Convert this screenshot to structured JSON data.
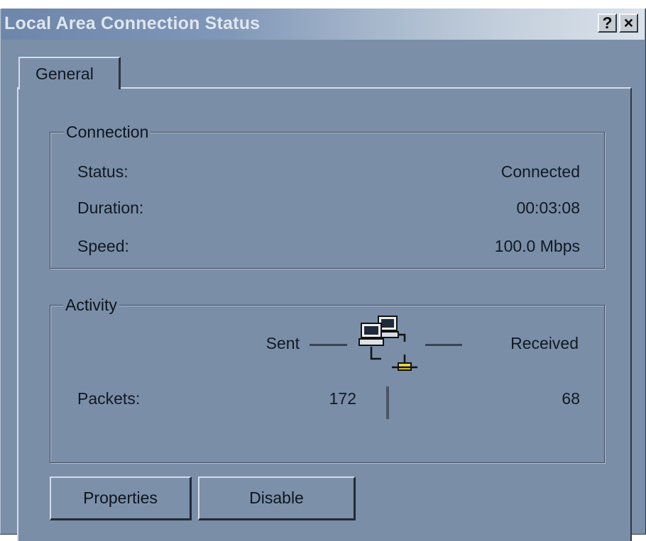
{
  "window": {
    "title": "Local Area Connection Status",
    "help_glyph": "?",
    "close_glyph": "×"
  },
  "tabs": [
    {
      "label": "General",
      "selected": true
    }
  ],
  "connection": {
    "legend": "Connection",
    "status_label": "Status:",
    "status_value": "Connected",
    "duration_label": "Duration:",
    "duration_value": "00:03:08",
    "speed_label": "Speed:",
    "speed_value": "100.0 Mbps"
  },
  "activity": {
    "legend": "Activity",
    "sent_label": "Sent",
    "received_label": "Received",
    "packets_label": "Packets:",
    "packets_sent": "172",
    "packets_received": "68",
    "icon": "network-computers-icon"
  },
  "buttons": {
    "properties": "Properties",
    "disable": "Disable"
  },
  "colors": {
    "face": "#7b8fa9",
    "title_start": "#6d86aa",
    "title_end": "#dbe2ea",
    "text": "#121922"
  }
}
